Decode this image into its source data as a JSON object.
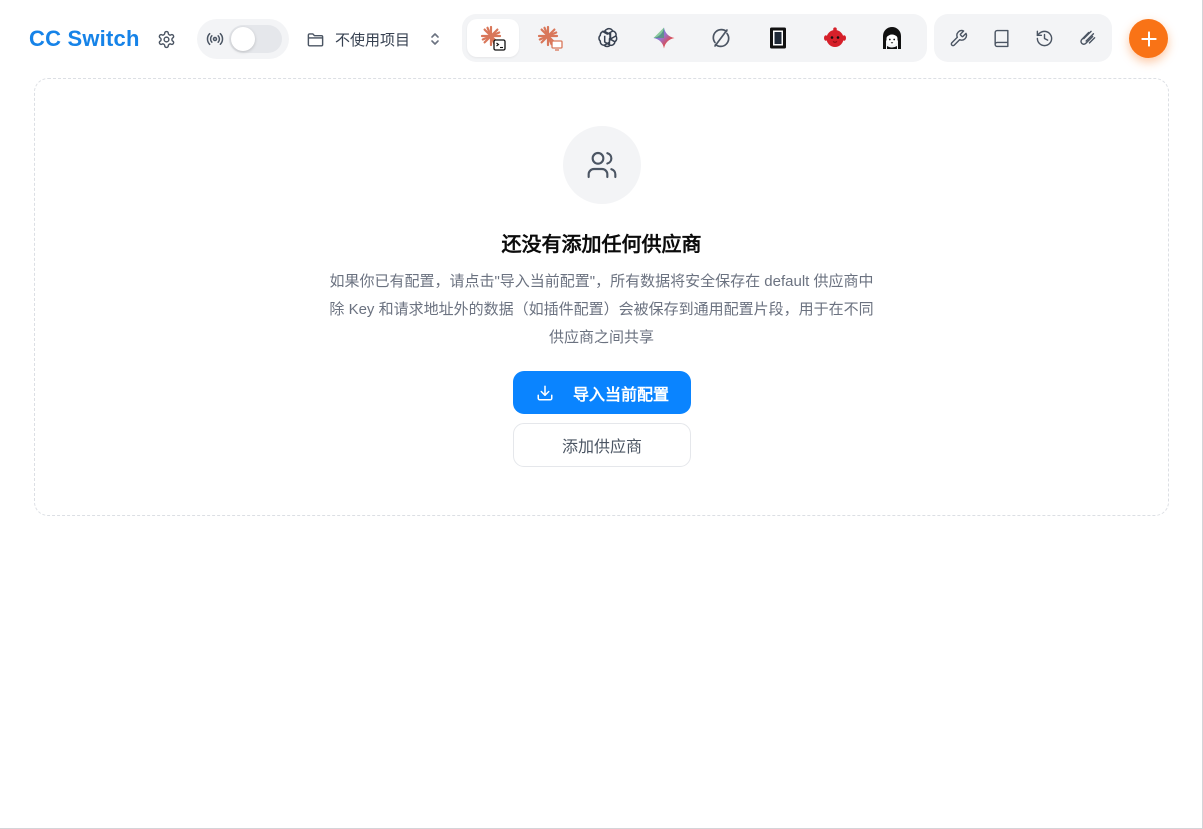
{
  "header": {
    "title": "CC Switch",
    "project": {
      "selected": "不使用项目"
    },
    "proxy_toggle": {
      "on": false
    },
    "app_tabs": [
      {
        "name": "claude-code-icon",
        "active": true
      },
      {
        "name": "claude-desktop-icon",
        "active": false
      },
      {
        "name": "openai-codex-icon",
        "active": false
      },
      {
        "name": "gemini-icon",
        "active": false
      },
      {
        "name": "opencode-icon",
        "active": false
      },
      {
        "name": "terminal-app-icon",
        "active": false
      },
      {
        "name": "red-mascot-icon",
        "active": false
      },
      {
        "name": "anime-girl-icon",
        "active": false
      }
    ],
    "tools": [
      "wrench-icon",
      "book-icon",
      "history-icon",
      "paperclip-icon"
    ]
  },
  "empty_state": {
    "title": "还没有添加任何供应商",
    "desc_line1": "如果你已有配置，请点击\"导入当前配置\"，所有数据将安全保存在 default 供应商中",
    "desc_line2": "除 Key 和请求地址外的数据（如插件配置）会被保存到通用配置片段，用于在不同",
    "desc_line3": "供应商之间共享",
    "import_label": "导入当前配置",
    "add_label": "添加供应商"
  },
  "colors": {
    "accent": "#1683e8",
    "primary_button": "#0a84ff",
    "fab": "#f97316"
  }
}
